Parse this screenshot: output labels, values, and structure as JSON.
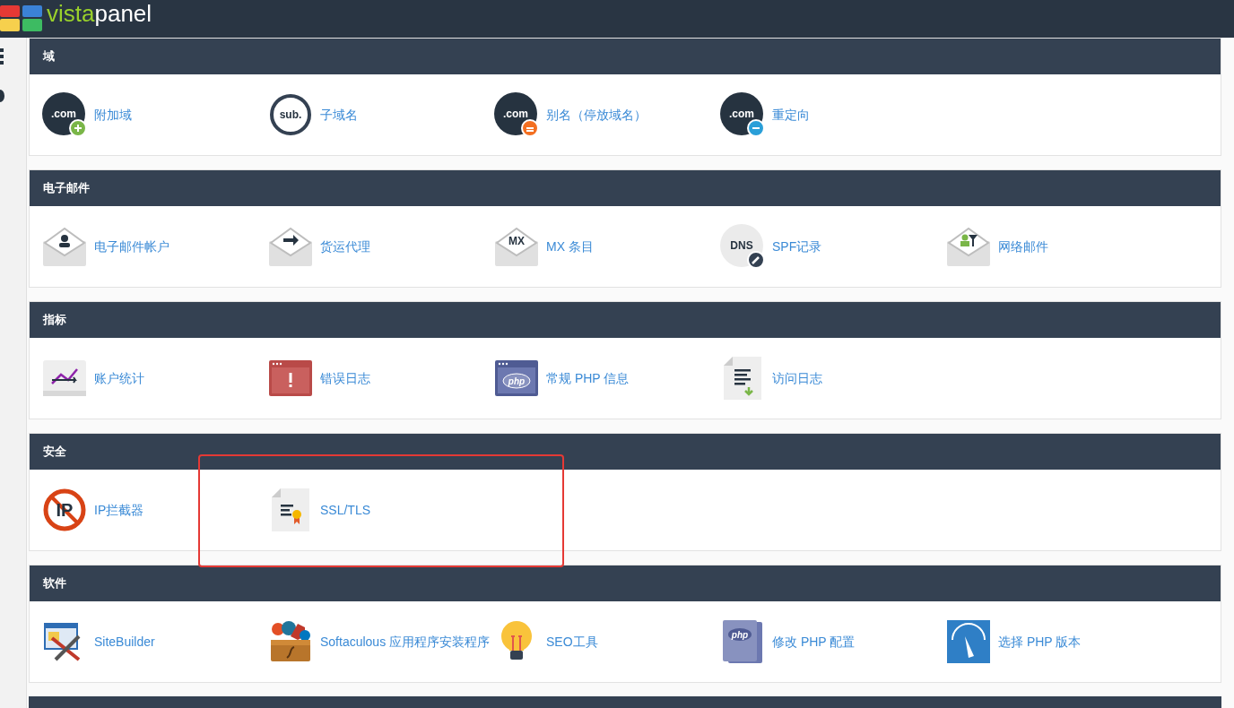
{
  "header": {
    "logo_accent": "vista",
    "logo_rest": "panel"
  },
  "sections": [
    {
      "title": "域",
      "items": [
        {
          "label": "附加域",
          "kind": "com-plus",
          "icon_text": ".com",
          "highlighted": false
        },
        {
          "label": "子域名",
          "kind": "sub",
          "icon_text": "sub.",
          "highlighted": false
        },
        {
          "label": "别名（停放域名）",
          "kind": "com-equals",
          "icon_text": ".com",
          "highlighted": false
        },
        {
          "label": "重定向",
          "kind": "com-redirect",
          "icon_text": ".com",
          "highlighted": false
        }
      ]
    },
    {
      "title": "电子邮件",
      "items": [
        {
          "label": "电子邮件帐户",
          "kind": "envelope-person",
          "highlighted": false
        },
        {
          "label": "货运代理",
          "kind": "envelope-arrow",
          "highlighted": false
        },
        {
          "label": "MX 条目",
          "kind": "envelope-text",
          "icon_text": "MX",
          "highlighted": false
        },
        {
          "label": "SPF记录",
          "kind": "dns-edit",
          "icon_text": "DNS",
          "highlighted": false
        },
        {
          "label": "网络邮件",
          "kind": "envelope-filter",
          "highlighted": false
        }
      ]
    },
    {
      "title": "指标",
      "items": [
        {
          "label": "账户统计",
          "kind": "chart",
          "highlighted": false
        },
        {
          "label": "错误日志",
          "kind": "error-window",
          "highlighted": false
        },
        {
          "label": "常规 PHP 信息",
          "kind": "php-window",
          "icon_text": "php",
          "highlighted": false
        },
        {
          "label": "访问日志",
          "kind": "log-file",
          "highlighted": false
        }
      ]
    },
    {
      "title": "安全",
      "items": [
        {
          "label": "IP拦截器",
          "kind": "no-ip",
          "icon_text": "IP",
          "highlighted": false
        },
        {
          "label": "SSL/TLS",
          "kind": "cert-file",
          "highlighted": true
        }
      ]
    },
    {
      "title": "软件",
      "items": [
        {
          "label": "SiteBuilder",
          "kind": "sitebuilder",
          "highlighted": false
        },
        {
          "label": "Softaculous 应用程序安装程序",
          "kind": "softaculous",
          "highlighted": false
        },
        {
          "label": "SEO工具",
          "kind": "bulb",
          "highlighted": false
        },
        {
          "label": "修改 PHP 配置",
          "kind": "php-file",
          "icon_text": "php",
          "highlighted": false
        },
        {
          "label": "选择 PHP 版本",
          "kind": "gauge",
          "highlighted": false
        }
      ]
    }
  ]
}
